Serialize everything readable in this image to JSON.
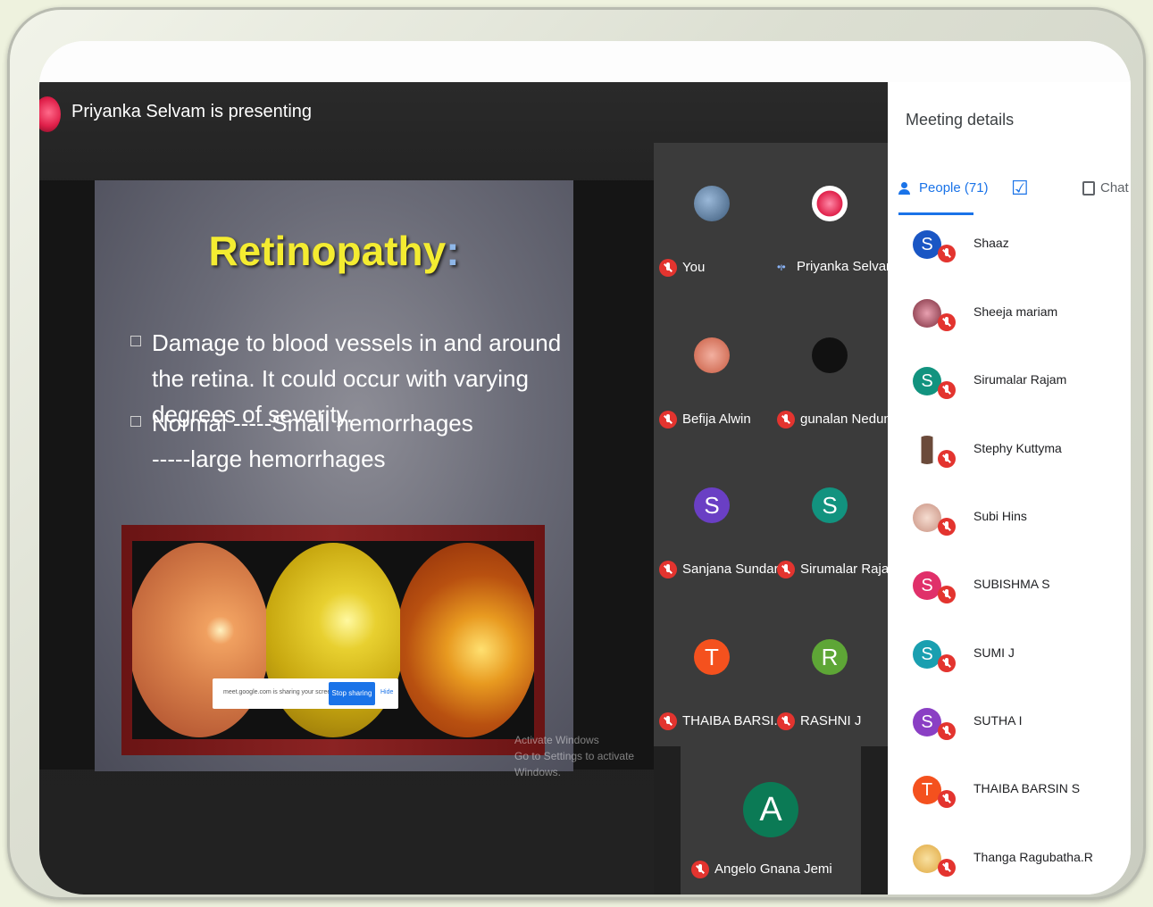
{
  "presenter": {
    "text": "Priyanka Selvam is presenting"
  },
  "slide": {
    "title": "Retinopathy",
    "title_suffix": ":",
    "bullets": [
      "Damage to blood vessels in and around the retina. It could occur with varying degrees of severity.",
      "Normal -----Small hemorrhages -----large hemorrhages"
    ]
  },
  "share_bar": {
    "text": "meet.google.com is sharing your screen.",
    "stop_label": "Stop sharing",
    "hide_label": "Hide"
  },
  "watermark": {
    "line1": "Activate Windows",
    "line2": "Go to Settings to activate Windows."
  },
  "tiles": [
    {
      "name": "You",
      "avatar": "",
      "avatar_color": "#5b7fa3",
      "muted": true
    },
    {
      "name": "Priyanka Selvam",
      "avatar": "",
      "avatar_color": "#e0204a",
      "muted": false
    },
    {
      "name": "Befija Alwin",
      "avatar": "",
      "avatar_color": "#d67a5a",
      "muted": true
    },
    {
      "name": "gunalan Nedun...",
      "avatar": "",
      "avatar_color": "#111111",
      "muted": true
    },
    {
      "name": "Sanjana Sundar",
      "avatar": "S",
      "avatar_color": "#6a3fc4",
      "muted": true
    },
    {
      "name": "Sirumalar Rajam",
      "avatar": "S",
      "avatar_color": "#12937f",
      "muted": true
    },
    {
      "name": "THAIBA BARSI...",
      "avatar": "T",
      "avatar_color": "#f4511e",
      "muted": true
    },
    {
      "name": "RASHNI J",
      "avatar": "R",
      "avatar_color": "#5ea636",
      "muted": true
    },
    {
      "name": "Angelo Gnana Jemi",
      "avatar": "A",
      "avatar_color": "#0b7a55",
      "muted": true
    }
  ],
  "panel": {
    "title": "Meeting details",
    "people_tab": "People (71)",
    "chat_tab": "Chat",
    "participants": [
      {
        "name": "Shaaz",
        "avatar": "S",
        "color": "#1a56c4"
      },
      {
        "name": "Sheeja mariam",
        "avatar": "",
        "color": "#7a2a3a"
      },
      {
        "name": "Sirumalar Rajam",
        "avatar": "S",
        "color": "#12937f"
      },
      {
        "name": "Stephy Kuttyma",
        "avatar": "",
        "color": "#6b4a3a"
      },
      {
        "name": "Subi Hins",
        "avatar": "",
        "color": "#d9b0a0"
      },
      {
        "name": "SUBISHMA S",
        "avatar": "S",
        "color": "#e0306a"
      },
      {
        "name": "SUMI J",
        "avatar": "S",
        "color": "#1a9fb0"
      },
      {
        "name": "SUTHA I",
        "avatar": "S",
        "color": "#8a3fc4"
      },
      {
        "name": "THAIBA BARSIN S",
        "avatar": "T",
        "color": "#f4511e"
      },
      {
        "name": "Thanga Ragubatha.R",
        "avatar": "",
        "color": "#e8c070"
      }
    ]
  }
}
